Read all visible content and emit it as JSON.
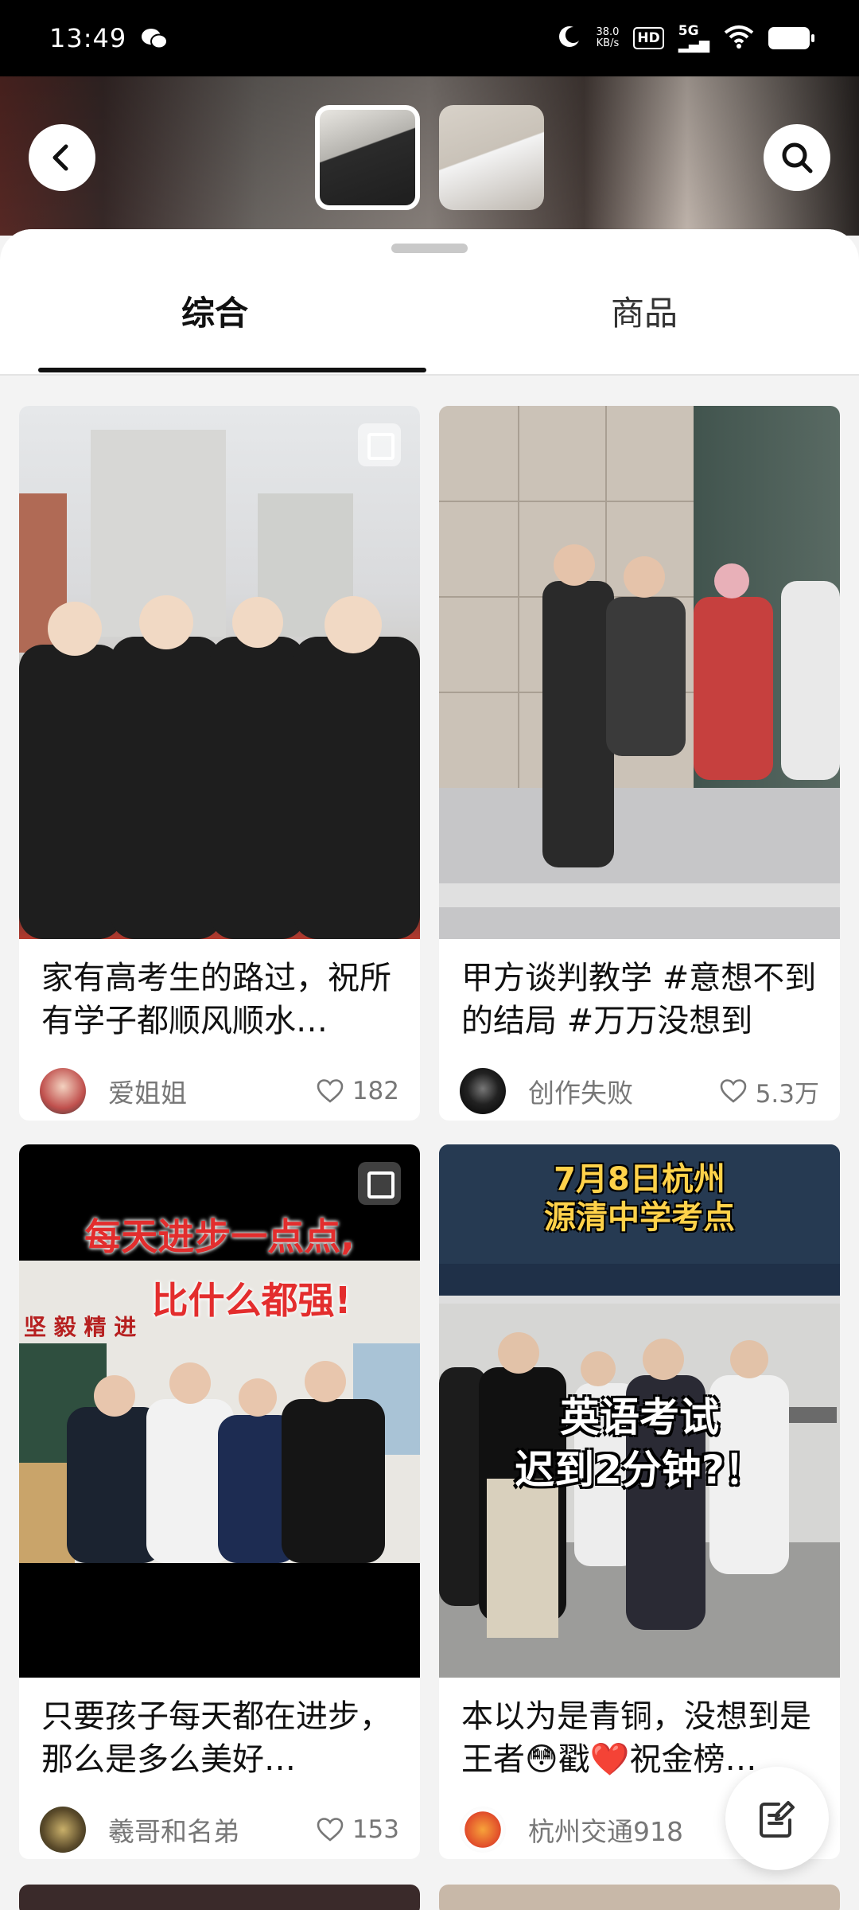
{
  "status": {
    "time": "13:49",
    "speed_top": "38.0",
    "speed_unit": "KB/s",
    "hd": "HD",
    "network": "5G"
  },
  "tabs": [
    {
      "label": "综合",
      "active": true
    },
    {
      "label": "商品",
      "active": false
    }
  ],
  "cards": [
    {
      "title": "家有高考生的路过，祝所有学子都顺风顺水…",
      "author": "爱姐姐",
      "likes": "182"
    },
    {
      "title": "甲方谈判教学 #意想不到的结局 #万万没想到 #…",
      "author": "创作失败",
      "likes": "5.3万"
    },
    {
      "title": "只要孩子每天都在进步，那么是多么美好…",
      "author": "羲哥和名弟",
      "likes": "153",
      "overlay": [
        "每天进步一点点,",
        "比什么都强!"
      ],
      "board_text": "坚 毅 精 进"
    },
    {
      "title": "本以为是青铜，没想到是王者😳戳❤️祝金榜…",
      "author": "杭州交通918",
      "likes": "",
      "overlay_top": [
        "7月8日杭州",
        "源清中学考点"
      ],
      "overlay_mid": [
        "英语考试",
        "迟到2分钟?！"
      ]
    }
  ],
  "colors": {
    "accent": "#111111",
    "like_gray": "#777777"
  }
}
